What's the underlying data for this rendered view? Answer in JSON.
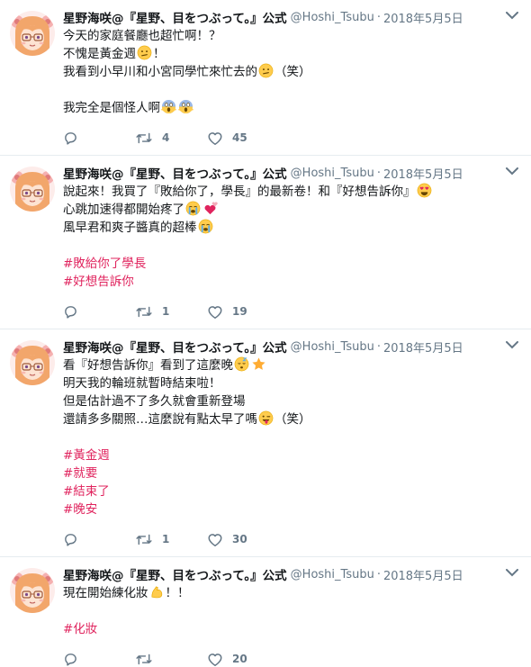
{
  "tweets": [
    {
      "name": "星野海咲@『星野、目をつぶって。』公式",
      "handle": "@Hoshi_Tsubu",
      "time": "2018年5月5日",
      "lines": [
        [
          {
            "t": "今天的家庭餐廳也超忙啊！？"
          }
        ],
        [
          {
            "t": "不愧是黃金週"
          },
          {
            "e": "confused-face-emoji"
          },
          {
            "t": "！"
          }
        ],
        [
          {
            "t": "我看到小早川和小宮同學忙來忙去的"
          },
          {
            "e": "confused-face-emoji"
          },
          {
            "t": "（笑）"
          }
        ],
        [],
        [
          {
            "t": "我完全是個怪人啊"
          },
          {
            "e": "screaming-face-emoji"
          },
          {
            "e": "screaming-face-emoji"
          }
        ]
      ],
      "replies": "",
      "retweets": "4",
      "likes": "45"
    },
    {
      "name": "星野海咲@『星野、目をつぶって。』公式",
      "handle": "@Hoshi_Tsubu",
      "time": "2018年5月5日",
      "lines": [
        [
          {
            "t": "說起來！我買了『敗給你了，學長』的最新卷！和『好想告訴你』"
          },
          {
            "e": "heart-eyes-emoji"
          }
        ],
        [
          {
            "t": "心跳加速得都開始疼了"
          },
          {
            "e": "crying-face-emoji"
          },
          {
            "e": "two-hearts-emoji"
          }
        ],
        [
          {
            "t": "風早君和爽子醬真的超棒"
          },
          {
            "e": "crying-face-emoji"
          }
        ],
        [],
        [
          {
            "h": "#敗給你了學長"
          }
        ],
        [
          {
            "h": "#好想告訴你"
          }
        ]
      ],
      "replies": "",
      "retweets": "1",
      "likes": "19"
    },
    {
      "name": "星野海咲@『星野、目をつぶって。』公式",
      "handle": "@Hoshi_Tsubu",
      "time": "2018年5月5日",
      "lines": [
        [
          {
            "t": "看『好想告訴你』看到了這麼晚"
          },
          {
            "e": "sleepy-face-emoji"
          },
          {
            "e": "star-emoji"
          }
        ],
        [
          {
            "t": "明天我的輪班就暫時結束啦！"
          }
        ],
        [
          {
            "t": "但是估計過不了多久就會重新登場"
          }
        ],
        [
          {
            "t": "還請多多關照…這麼說有點太早了嗎"
          },
          {
            "e": "tongue-wink-emoji"
          },
          {
            "t": "（笑）"
          }
        ],
        [],
        [
          {
            "h": "#黃金週"
          }
        ],
        [
          {
            "h": "#就要"
          }
        ],
        [
          {
            "h": "#結束了"
          }
        ],
        [
          {
            "h": "#晚安"
          }
        ]
      ],
      "replies": "",
      "retweets": "1",
      "likes": "30"
    },
    {
      "name": "星野海咲@『星野、目をつぶって。』公式",
      "handle": "@Hoshi_Tsubu",
      "time": "2018年5月5日",
      "lines": [
        [
          {
            "t": "現在開始練化妝"
          },
          {
            "e": "flexed-bicep-emoji"
          },
          {
            "t": "！！"
          }
        ],
        [],
        [
          {
            "h": "#化妝"
          }
        ]
      ],
      "replies": "",
      "retweets": "",
      "likes": "20"
    }
  ],
  "colors": {
    "text": "#14171a",
    "muted": "#657786",
    "hashtag": "#e0245e",
    "divider": "#e6ecf0",
    "emoji_yellow": "#ffcc4d",
    "hair": "#f2a66b"
  }
}
